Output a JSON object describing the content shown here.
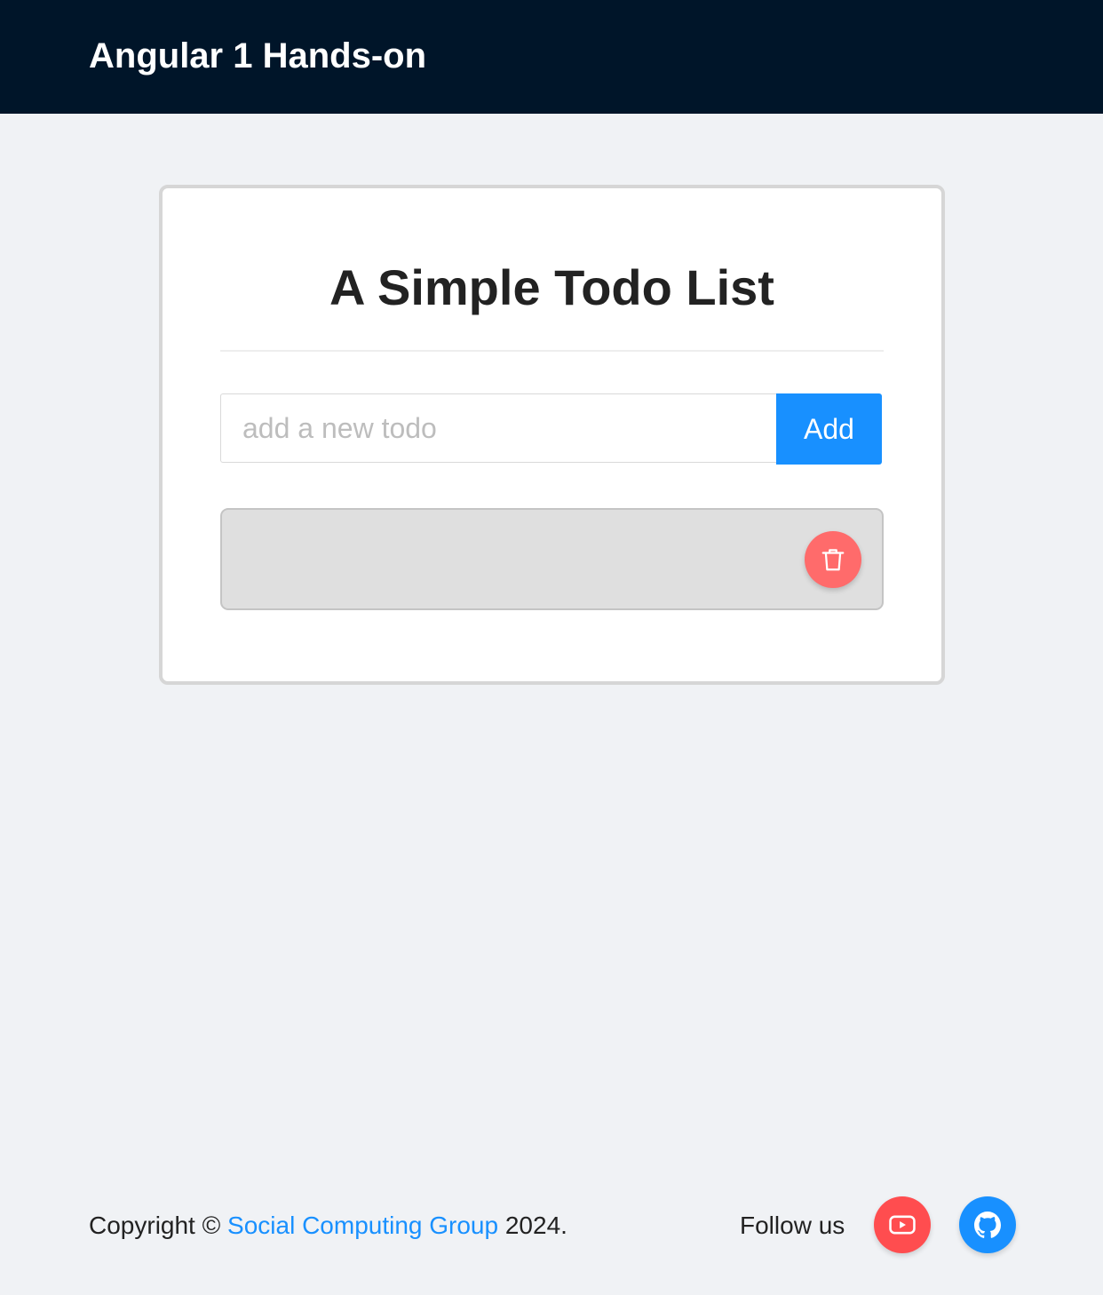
{
  "header": {
    "title": "Angular 1 Hands-on"
  },
  "todo": {
    "title": "A Simple Todo List",
    "input_value": "",
    "input_placeholder": "add a new todo",
    "add_label": "Add",
    "items": [
      {
        "text": ""
      }
    ]
  },
  "footer": {
    "copyright_prefix": "Copyright © ",
    "company_link": "Social Computing Group",
    "copyright_suffix": " 2024.",
    "follow_label": "Follow us"
  },
  "icons": {
    "delete": "trash-icon",
    "youtube": "youtube-icon",
    "github": "github-icon"
  },
  "colors": {
    "header_bg": "#001529",
    "accent": "#1890ff",
    "delete": "#ff6b6b",
    "youtube": "#ff4d4f",
    "page_bg": "#f0f2f5"
  }
}
